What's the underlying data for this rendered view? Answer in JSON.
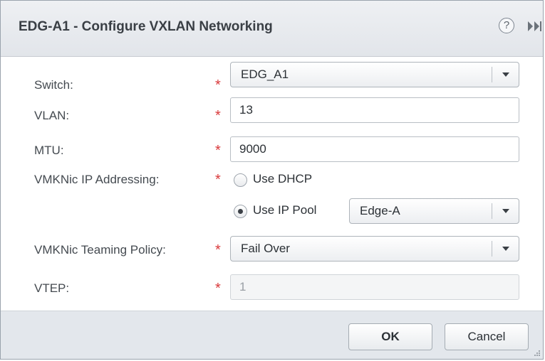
{
  "dialog": {
    "title": "EDG-A1 - Configure VXLAN Networking",
    "help_glyph": "?",
    "icons": [
      "help-icon",
      "expand-icon"
    ]
  },
  "form": {
    "switch": {
      "label": "Switch:",
      "required_mark": "*",
      "value": "EDG_A1"
    },
    "vlan": {
      "label": "VLAN:",
      "required_mark": "*",
      "value": "13"
    },
    "mtu": {
      "label": "MTU:",
      "required_mark": "*",
      "value": "9000"
    },
    "vmknic_ip": {
      "label": "VMKNic IP Addressing:",
      "required_mark": "*",
      "option_dhcp": "Use DHCP",
      "option_pool": "Use IP Pool",
      "selected": "Use IP Pool",
      "pool_value": "Edge-A"
    },
    "teaming": {
      "label": "VMKNic Teaming Policy:",
      "required_mark": "*",
      "value": "Fail Over"
    },
    "vtep": {
      "label": "VTEP:",
      "required_mark": "*",
      "value": "1"
    }
  },
  "buttons": {
    "ok": "OK",
    "cancel": "Cancel"
  },
  "colors": {
    "required": "#d9383a",
    "header_bg": "#e2e5ea",
    "footer_bg": "#e3e7ec"
  }
}
